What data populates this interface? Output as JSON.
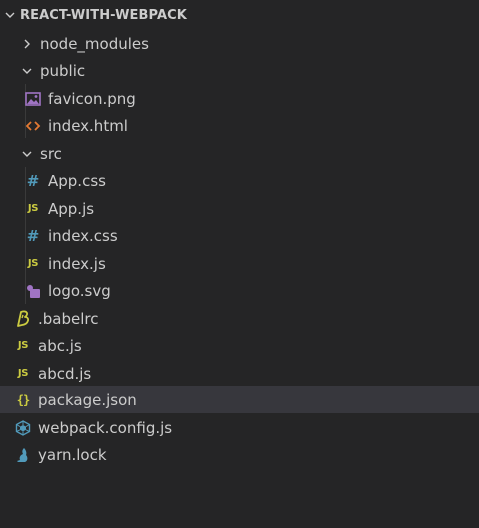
{
  "explorer": {
    "title": "REACT-WITH-WEBPACK",
    "colors": {
      "background": "#252526",
      "selection": "#37373d",
      "text": "#cccccc",
      "js": "#cbcb41",
      "css": "#519aba",
      "html": "#e37933",
      "image": "#a074c4",
      "webpack": "#519aba",
      "babel": "#cbcb41",
      "yarn": "#519aba"
    },
    "items": [
      {
        "label": "node_modules",
        "type": "folder",
        "expanded": false,
        "icon": "chevron-right-icon"
      },
      {
        "label": "public",
        "type": "folder",
        "expanded": true,
        "icon": "chevron-down-icon"
      },
      {
        "label": "favicon.png",
        "type": "file",
        "icon": "image-file-icon"
      },
      {
        "label": "index.html",
        "type": "file",
        "icon": "html-file-icon"
      },
      {
        "label": "src",
        "type": "folder",
        "expanded": true,
        "icon": "chevron-down-icon"
      },
      {
        "label": "App.css",
        "type": "file",
        "icon": "css-file-icon"
      },
      {
        "label": "App.js",
        "type": "file",
        "icon": "js-file-icon"
      },
      {
        "label": "index.css",
        "type": "file",
        "icon": "css-file-icon"
      },
      {
        "label": "index.js",
        "type": "file",
        "icon": "js-file-icon"
      },
      {
        "label": "logo.svg",
        "type": "file",
        "icon": "svg-file-icon"
      },
      {
        "label": ".babelrc",
        "type": "file",
        "icon": "babel-file-icon"
      },
      {
        "label": "abc.js",
        "type": "file",
        "icon": "js-file-icon"
      },
      {
        "label": "abcd.js",
        "type": "file",
        "icon": "js-file-icon"
      },
      {
        "label": "package.json",
        "type": "file",
        "icon": "json-file-icon",
        "selected": true
      },
      {
        "label": "webpack.config.js",
        "type": "file",
        "icon": "webpack-file-icon"
      },
      {
        "label": "yarn.lock",
        "type": "file",
        "icon": "yarn-file-icon"
      }
    ],
    "badges": {
      "js": "JS",
      "css": "#",
      "json": "{}"
    }
  }
}
